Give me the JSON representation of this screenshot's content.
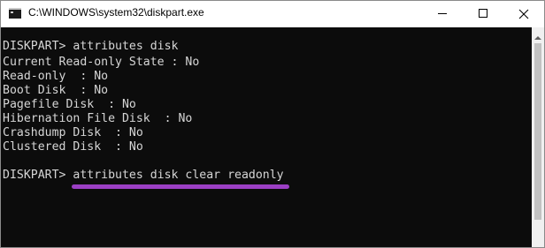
{
  "window": {
    "title": "C:\\WINDOWS\\system32\\diskpart.exe",
    "icon": "console-icon",
    "controls": {
      "minimize": "minimize-icon",
      "maximize": "maximize-icon",
      "close": "close-icon"
    }
  },
  "console": {
    "lines": [
      "DISKPART> attributes disk",
      "Current Read-only State : No",
      "Read-only  : No",
      "Boot Disk  : No",
      "Pagefile Disk  : No",
      "Hibernation File Disk  : No",
      "Crashdump Disk  : No",
      "Clustered Disk  : No",
      "",
      "DISKPART> attributes disk clear readonly"
    ],
    "text_color": "#d6d6d6",
    "background_color": "#0c0c0c",
    "highlight_color": "#9b3fc4"
  }
}
